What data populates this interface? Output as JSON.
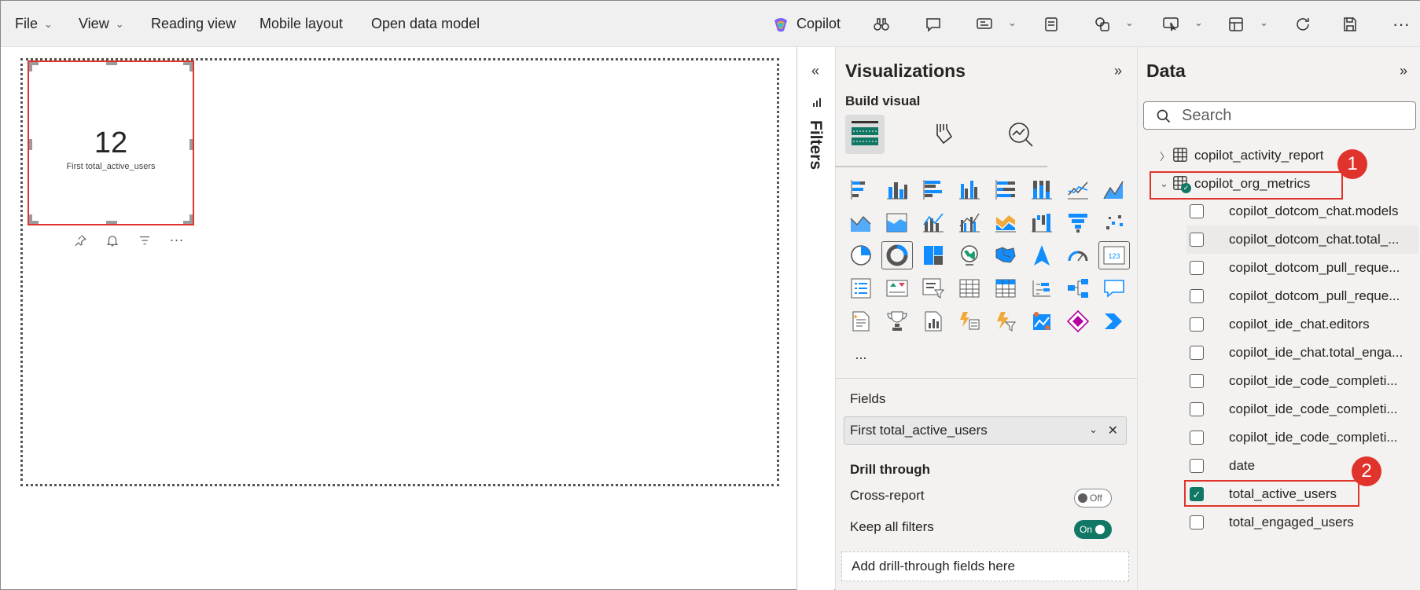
{
  "menu": {
    "file": "File",
    "view": "View",
    "reading_view": "Reading view",
    "mobile_layout": "Mobile layout",
    "open_data_model": "Open data model",
    "copilot": "Copilot"
  },
  "card": {
    "value": "12",
    "label": "First total_active_users"
  },
  "filters": {
    "title": "Filters"
  },
  "viz": {
    "title": "Visualizations",
    "build_visual": "Build visual",
    "more": "...",
    "fields_label": "Fields",
    "field_value": "First total_active_users",
    "drill_through": "Drill through",
    "cross_report": "Cross-report",
    "cross_report_state": "Off",
    "keep_filters": "Keep all filters",
    "keep_filters_state": "On",
    "drop_hint": "Add drill-through fields here"
  },
  "data": {
    "title": "Data",
    "search_placeholder": "Search",
    "tables": [
      {
        "name": "copilot_activity_report"
      },
      {
        "name": "copilot_org_metrics"
      }
    ],
    "columns": [
      {
        "name": "copilot_dotcom_chat.models",
        "checked": false
      },
      {
        "name": "copilot_dotcom_chat.total_...",
        "checked": false
      },
      {
        "name": "copilot_dotcom_pull_reque...",
        "checked": false
      },
      {
        "name": "copilot_dotcom_pull_reque...",
        "checked": false
      },
      {
        "name": "copilot_ide_chat.editors",
        "checked": false
      },
      {
        "name": "copilot_ide_chat.total_enga...",
        "checked": false
      },
      {
        "name": "copilot_ide_code_completi...",
        "checked": false
      },
      {
        "name": "copilot_ide_code_completi...",
        "checked": false
      },
      {
        "name": "copilot_ide_code_completi...",
        "checked": false
      },
      {
        "name": "date",
        "checked": false
      },
      {
        "name": "total_active_users",
        "checked": true
      },
      {
        "name": "total_engaged_users",
        "checked": false
      }
    ]
  },
  "annotations": {
    "badge1": "1",
    "badge2": "2"
  },
  "colors": {
    "accent": "#117865",
    "highlight": "#e0332b",
    "copilot": "#7b61ff"
  }
}
